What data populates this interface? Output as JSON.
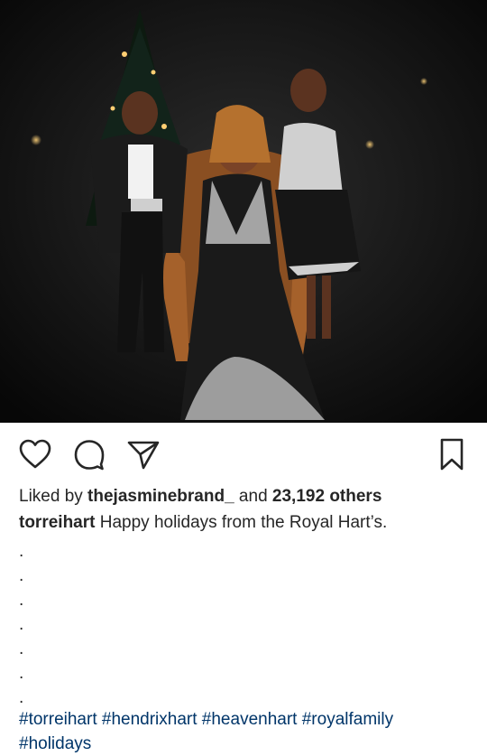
{
  "post": {
    "image_alt": "Family holiday portrait",
    "actions": {
      "like_icon": "heart-icon",
      "comment_icon": "speech-bubble-icon",
      "share_icon": "paper-plane-icon",
      "save_icon": "bookmark-icon"
    },
    "likes": {
      "prefix": "Liked by ",
      "user": "thejasminebrand_",
      "middle": " and ",
      "count": "23,192 others"
    },
    "caption": {
      "username": "torreihart",
      "text": " Happy holidays from the Royal Hart’s."
    },
    "dots": [
      ".",
      ".",
      ".",
      ".",
      ".",
      ".",
      "."
    ],
    "hashtags": [
      "#torreihart",
      "#hendrixhart",
      "#heavenhart",
      "#royalfamily",
      "#holidays"
    ]
  },
  "colors": {
    "text": "#262626",
    "hashtag": "#003569",
    "background": "#ffffff"
  }
}
